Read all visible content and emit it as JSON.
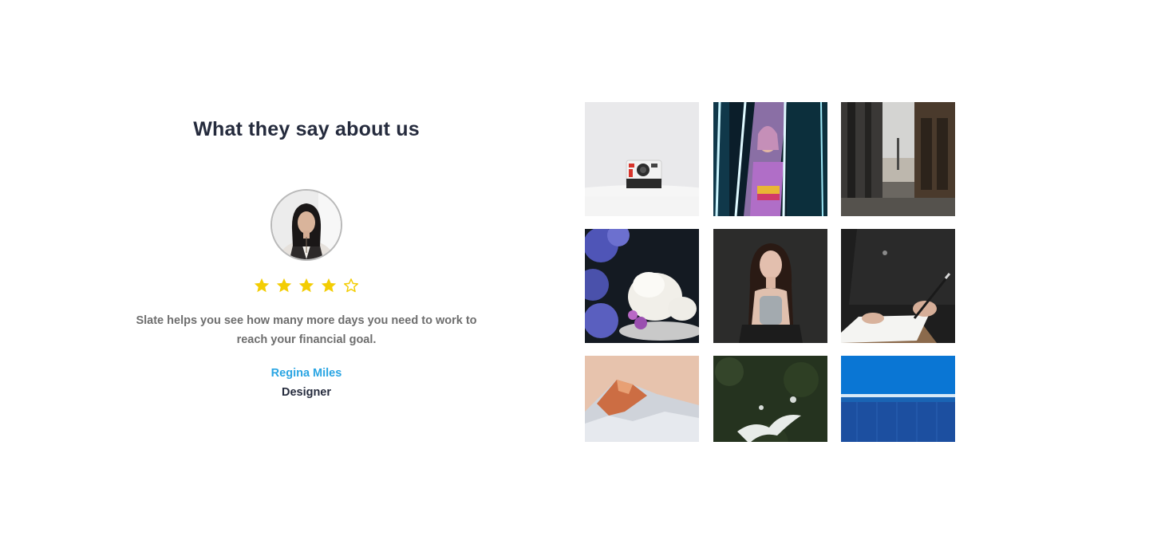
{
  "testimonials": {
    "title": "What they say about us",
    "rating": {
      "value": 4,
      "max": 5
    },
    "quote": "Slate helps you see how many more days you need to work to reach your financial goal.",
    "author": {
      "name": "Regina Miles",
      "role": "Designer"
    }
  },
  "colors": {
    "heading": "#252b3d",
    "body_text": "#6e6e6e",
    "author_name": "#2aa5e3",
    "star": "#f3cd03"
  },
  "icons": {
    "star_filled": "star-filled-icon",
    "star_empty": "star-outline-icon"
  },
  "gallery": {
    "images": [
      "polaroid-camera-photo",
      "neon-portrait-photo",
      "paris-street-photo",
      "meringue-flowers-photo",
      "woman-portrait-photo",
      "writing-hand-photo",
      "mountain-peak-photo",
      "forest-aerial-photo",
      "blue-building-photo"
    ]
  }
}
